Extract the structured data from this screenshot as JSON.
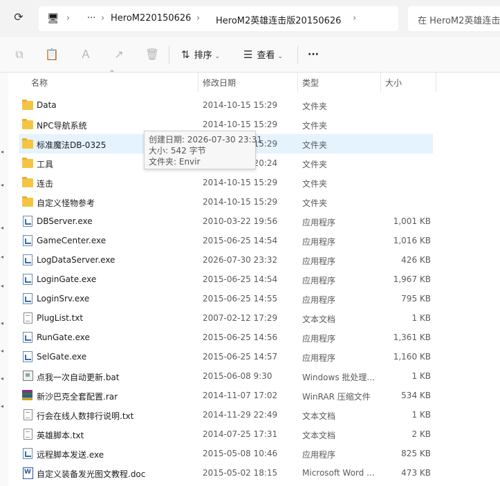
{
  "address": {
    "refresh_icon": "refresh-icon",
    "crumbs": [
      "HeroM220150626",
      "HeroM2英雄连击版20150626"
    ],
    "search_placeholder": "在 HeroM2英雄连击"
  },
  "toolbar": {
    "sort_label": "排序",
    "view_label": "查看",
    "more_label": "···"
  },
  "columns": {
    "name": "名称",
    "date": "修改日期",
    "type": "类型",
    "size": "大小"
  },
  "files": [
    {
      "icon": "folder",
      "name": "Data",
      "date": "2014-10-15 15:29",
      "type": "文件夹",
      "size": ""
    },
    {
      "icon": "folder",
      "name": "NPC导航系统",
      "date": "2014-10-15 15:29",
      "type": "文件夹",
      "size": ""
    },
    {
      "icon": "folder",
      "name": "标准魔法DB-0325",
      "date": "2014-10-15 15:29",
      "type": "文件夹",
      "size": ""
    },
    {
      "icon": "folder",
      "name": "工具",
      "date": "2015-02-08 20:24",
      "type": "文件夹",
      "size": ""
    },
    {
      "icon": "folder",
      "name": "连击",
      "date": "2014-10-15 15:29",
      "type": "文件夹",
      "size": ""
    },
    {
      "icon": "folder",
      "name": "自定义怪物参考",
      "date": "2014-10-15 15:29",
      "type": "文件夹",
      "size": ""
    },
    {
      "icon": "exe",
      "name": "DBServer.exe",
      "date": "2010-03-22 19:56",
      "type": "应用程序",
      "size": "1,001 KB"
    },
    {
      "icon": "exe",
      "name": "GameCenter.exe",
      "date": "2015-06-25 14:54",
      "type": "应用程序",
      "size": "1,016 KB"
    },
    {
      "icon": "exe",
      "name": "LogDataServer.exe",
      "date": "2026-07-30 23:32",
      "type": "应用程序",
      "size": "426 KB"
    },
    {
      "icon": "exe",
      "name": "LoginGate.exe",
      "date": "2015-06-25 14:54",
      "type": "应用程序",
      "size": "1,967 KB"
    },
    {
      "icon": "exe",
      "name": "LoginSrv.exe",
      "date": "2015-06-25 14:55",
      "type": "应用程序",
      "size": "795 KB"
    },
    {
      "icon": "txt",
      "name": "PlugList.txt",
      "date": "2007-02-12 17:29",
      "type": "文本文档",
      "size": "1 KB"
    },
    {
      "icon": "exe",
      "name": "RunGate.exe",
      "date": "2015-06-25 14:56",
      "type": "应用程序",
      "size": "1,361 KB"
    },
    {
      "icon": "exe",
      "name": "SelGate.exe",
      "date": "2015-06-25 14:57",
      "type": "应用程序",
      "size": "1,160 KB"
    },
    {
      "icon": "bat",
      "name": "点我一次自动更新.bat",
      "date": "2015-06-08 9:30",
      "type": "Windows 批处理...",
      "size": "1 KB"
    },
    {
      "icon": "rar",
      "name": "新沙巴克全套配置.rar",
      "date": "2014-11-07 17:02",
      "type": "WinRAR 压缩文件",
      "size": "534 KB"
    },
    {
      "icon": "txt",
      "name": "行会在线人数排行说明.txt",
      "date": "2014-11-29 22:49",
      "type": "文本文档",
      "size": "1 KB"
    },
    {
      "icon": "txt",
      "name": "英雄脚本.txt",
      "date": "2014-07-25 17:31",
      "type": "文本文档",
      "size": "2 KB"
    },
    {
      "icon": "exe",
      "name": "远程脚本发送.exe",
      "date": "2015-05-08 10:46",
      "type": "应用程序",
      "size": "825 KB"
    },
    {
      "icon": "doc",
      "name": "自定义装备发光图文教程.doc",
      "date": "2015-05-02 18:15",
      "type": "Microsoft Word ...",
      "size": "473 KB"
    }
  ],
  "selected_index": 2,
  "tooltip": {
    "created": "创建日期: 2026-07-30 23:31",
    "size": "大小: 542 字节",
    "folder": "文件夹: Envir"
  }
}
